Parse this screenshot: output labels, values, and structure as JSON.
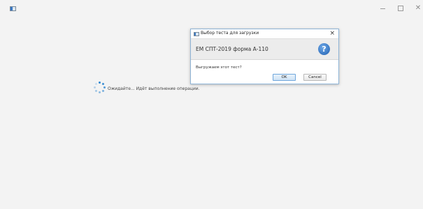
{
  "window": {
    "controls": {
      "minimize": "minimize-icon",
      "maximize": "maximize-icon",
      "close": "close-icon"
    }
  },
  "status": {
    "text": "Ожидайте... Идёт выполнение операции."
  },
  "dialog": {
    "title": "Выбор теста для загрузки",
    "close_glyph": "×",
    "header_text": "ЕМ СПТ-2019 форма А-110",
    "help_glyph": "?",
    "question": "Выгружаем этот тест?",
    "ok_label": "OK",
    "cancel_label": "Cancel"
  },
  "colors": {
    "accent": "#2e86d0",
    "background": "#f3f3f3",
    "dialog_border": "#8fb4d6"
  }
}
